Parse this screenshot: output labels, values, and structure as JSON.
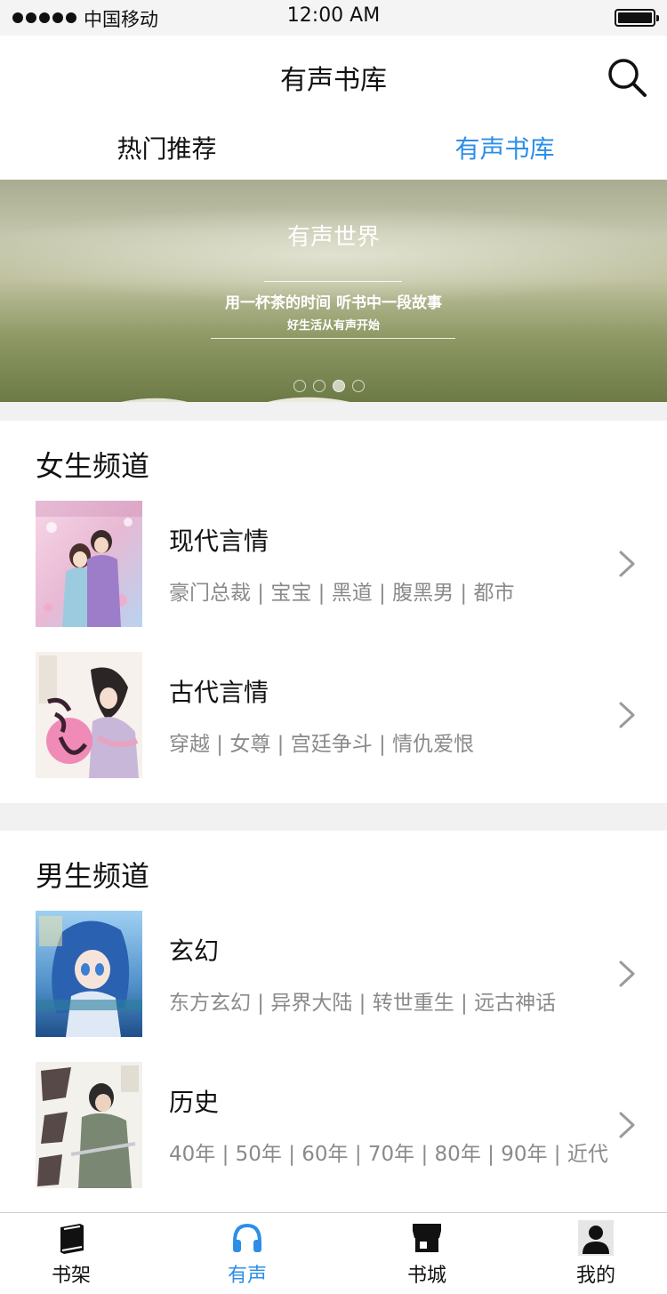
{
  "status_bar": {
    "carrier": "中国移动",
    "time": "12:00 AM"
  },
  "nav": {
    "title": "有声书库",
    "search_icon": "search-icon"
  },
  "tabs": [
    {
      "label": "热门推荐",
      "active": false
    },
    {
      "label": "有声书库",
      "active": true
    }
  ],
  "banner": {
    "title": "有声世界",
    "subtitle": "用一杯茶的时间  听书中一段故事",
    "tagline": "好生活从有声开始",
    "dots_total": 4,
    "active_dot": 3
  },
  "sections": [
    {
      "title": "女生频道",
      "items": [
        {
          "title": "现代言情",
          "tags": "豪门总裁 | 宝宝 | 黑道 | 腹黑男 | 都市"
        },
        {
          "title": "古代言情",
          "tags": "穿越 | 女尊 | 宫廷争斗 | 情仇爱恨"
        }
      ]
    },
    {
      "title": "男生频道",
      "items": [
        {
          "title": "玄幻",
          "tags": "东方玄幻 | 异界大陆 | 转世重生 | 远古神话"
        },
        {
          "title": "历史",
          "tags": "40年 | 50年 | 60年 | 70年 | 80年 | 90年 | 近代"
        }
      ]
    }
  ],
  "tabbar": [
    {
      "label": "书架",
      "icon": "book-icon",
      "active": false
    },
    {
      "label": "有声",
      "icon": "headphones-icon",
      "active": true
    },
    {
      "label": "书城",
      "icon": "store-icon",
      "active": false
    },
    {
      "label": "我的",
      "icon": "user-icon",
      "active": false
    }
  ],
  "colors": {
    "accent": "#2d8ee8",
    "text": "#111111",
    "muted": "#8a8a8a",
    "divider_bg": "#f1f1f1"
  }
}
